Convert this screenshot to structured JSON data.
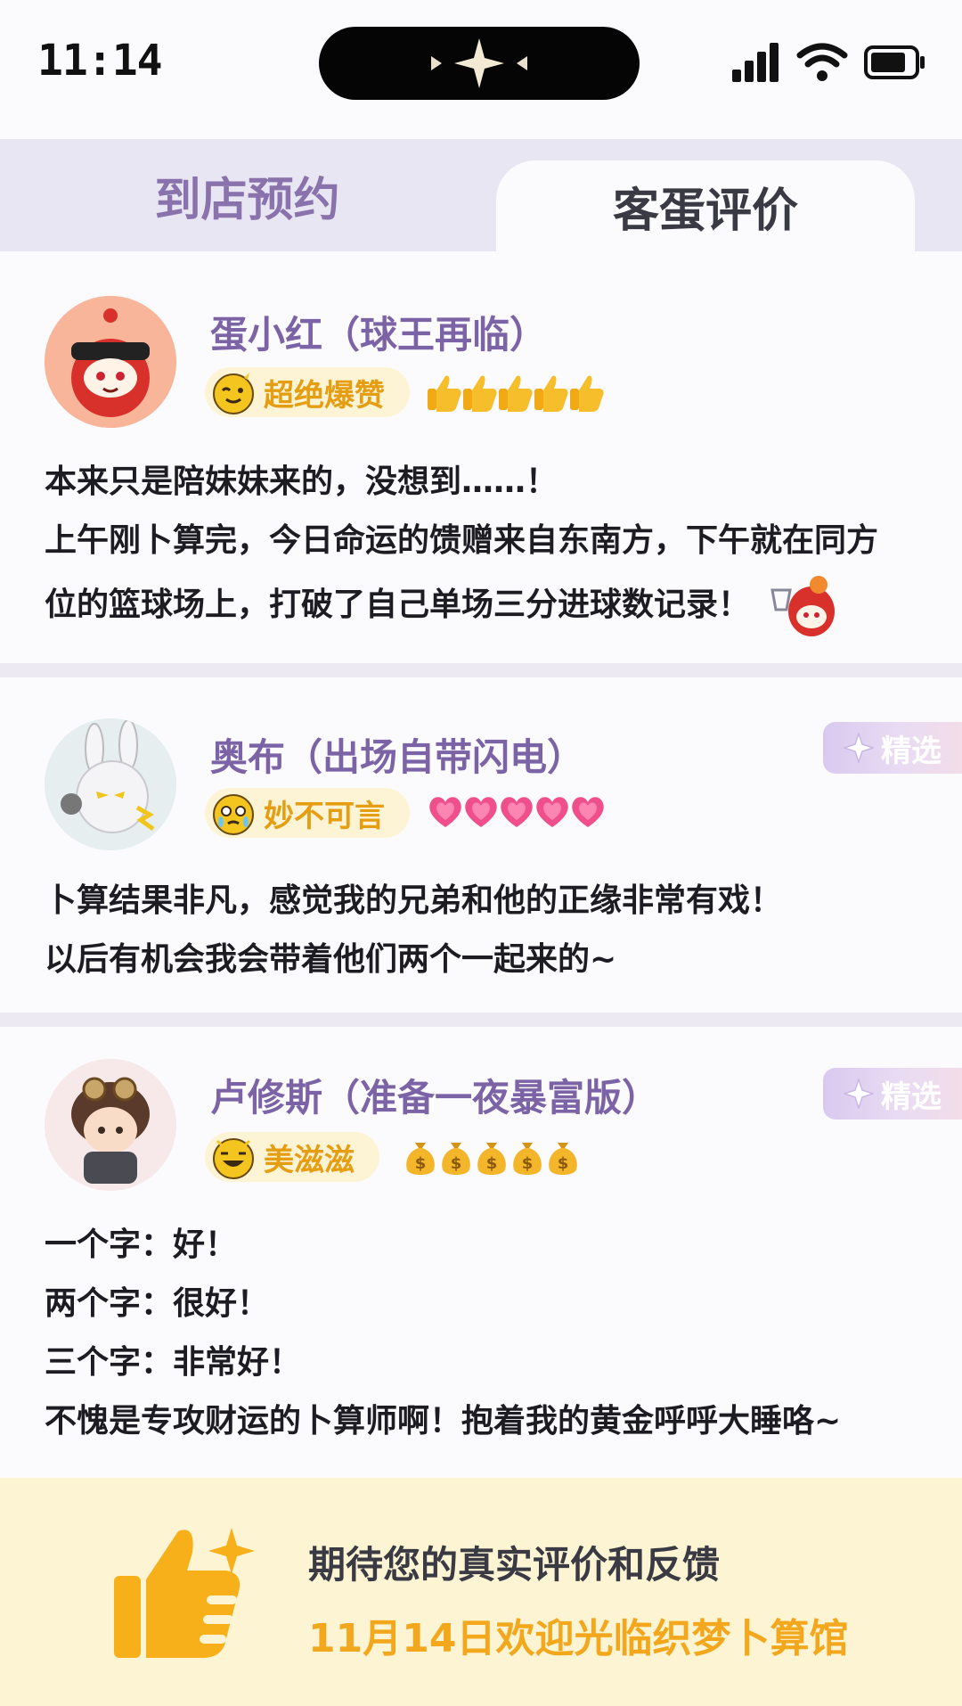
{
  "status_bar": {
    "time": "11:14"
  },
  "tabs": [
    {
      "label": "到店预约",
      "active": false
    },
    {
      "label": "客蛋评价",
      "active": true
    }
  ],
  "reviews": [
    {
      "name": "蛋小红（球王再临）",
      "badge": "超绝爆赞",
      "rating_icon": "thumbs-up-icon",
      "rating_count": 5,
      "featured": false,
      "lines": [
        "本来只是陪妹妹来的，没想到……！",
        "上午刚卜算完，今日命运的馈赠来自东南方，下午就在同方",
        "位的篮球场上，打破了自己单场三分进球数记录！"
      ]
    },
    {
      "name": "奥布（出场自带闪电）",
      "badge": "妙不可言",
      "rating_icon": "heart-icon",
      "rating_count": 5,
      "featured": true,
      "featured_label": "精选",
      "lines": [
        "卜算结果非凡，感觉我的兄弟和他的正缘非常有戏！",
        "以后有机会我会带着他们两个一起来的~"
      ]
    },
    {
      "name": "卢修斯（准备一夜暴富版）",
      "badge": "美滋滋",
      "rating_icon": "money-bag-icon",
      "rating_count": 5,
      "featured": true,
      "featured_label": "精选",
      "lines": [
        "一个字：好！",
        "两个字：很好！",
        "三个字：非常好！",
        "不愧是专攻财运的卜算师啊！抱着我的黄金呼呼大睡咯~"
      ]
    }
  ],
  "footer": {
    "line1": "期待您的真实评价和反馈",
    "line2": "11月14日欢迎光临织梦卜算馆"
  },
  "colors": {
    "accent_purple": "#7b63a6",
    "badge_gold": "#e59d12",
    "footer_bg": "#fdf4d3",
    "footer_highlight": "#f2a71c"
  }
}
